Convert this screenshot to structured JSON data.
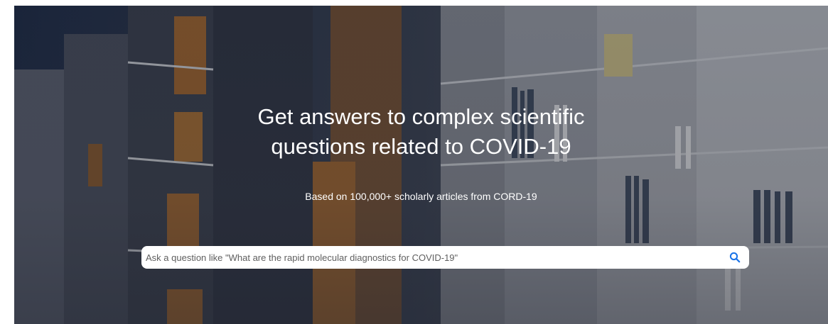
{
  "hero": {
    "headline_line1": "Get answers to complex scientific",
    "headline_line2": "questions related to COVID-19",
    "subheadline": "Based on 100,000+ scholarly articles from CORD-19",
    "background": "library-bookshelves-photo"
  },
  "search": {
    "placeholder": "Ask a question like \"What are the rapid molecular diagnostics for COVID-19\"",
    "value": "",
    "icon": "search-icon",
    "icon_color": "#1a73e8"
  }
}
